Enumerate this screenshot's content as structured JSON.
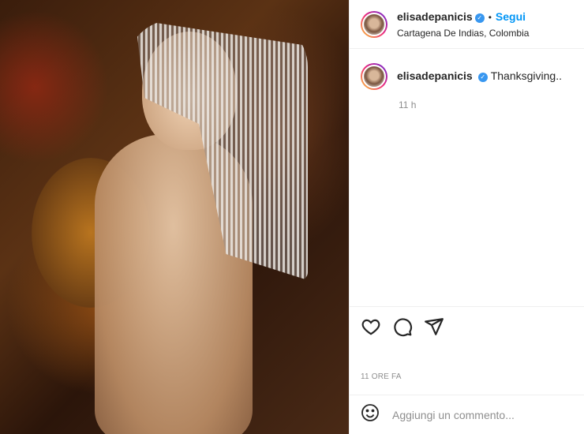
{
  "post": {
    "username": "elisadepanicis",
    "follow_label": "Segui",
    "location": "Cartagena De Indias, Colombia",
    "caption": "Thanksgiving..",
    "caption_time": "11 h",
    "time_ago": "11 ORE FA",
    "comment_placeholder": "Aggiungi un commento...",
    "verified_badge": "✓"
  },
  "icons": {
    "like": "heart-icon",
    "comment": "comment-icon",
    "share": "paper-plane-icon",
    "emoji": "emoji-icon"
  },
  "colors": {
    "accent": "#0095f6",
    "verified": "#3897f0",
    "muted": "#8e8e8e"
  }
}
